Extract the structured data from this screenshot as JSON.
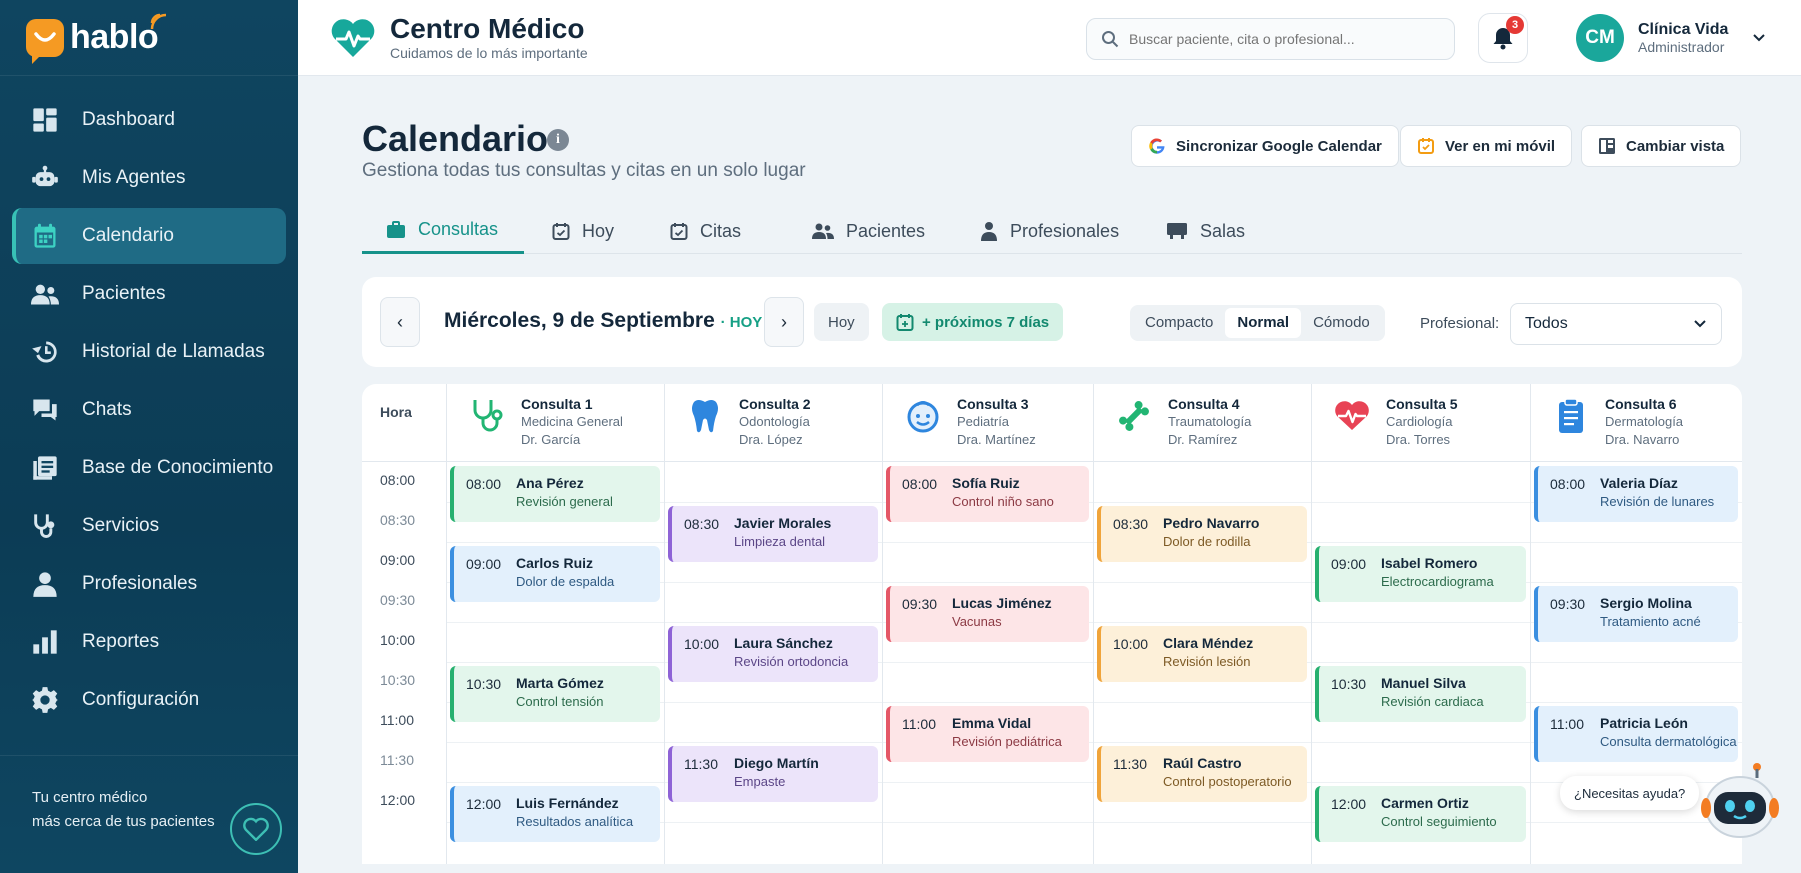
{
  "sidebar": {
    "logo": "hablo",
    "items": [
      {
        "label": "Dashboard",
        "icon": "dashboard-icon"
      },
      {
        "label": "Mis Agentes",
        "icon": "robot-icon"
      },
      {
        "label": "Calendario",
        "icon": "calendar-icon",
        "active": true
      },
      {
        "label": "Pacientes",
        "icon": "users-icon"
      },
      {
        "label": "Historial de Llamadas",
        "icon": "history-icon"
      },
      {
        "label": "Chats",
        "icon": "chat-icon"
      },
      {
        "label": "Base de Conocimiento",
        "icon": "book-icon"
      },
      {
        "label": "Servicios",
        "icon": "stethoscope-icon"
      },
      {
        "label": "Profesionales",
        "icon": "person-icon"
      },
      {
        "label": "Reportes",
        "icon": "bar-chart-icon"
      },
      {
        "label": "Configuración",
        "icon": "gear-icon"
      }
    ],
    "footer_line1": "Tu centro médico",
    "footer_line2": "más cerca de tus pacientes"
  },
  "topbar": {
    "brand_title": "Centro Médico",
    "brand_subtitle": "Cuidamos de lo más importante",
    "search_placeholder": "Buscar paciente, cita o profesional...",
    "notifications_count": "3",
    "avatar_initials": "CM",
    "user_name": "Clínica Vida",
    "user_role": "Administrador"
  },
  "page": {
    "title": "Calendario",
    "subtitle": "Gestiona todas tus consultas y citas en un solo lugar",
    "actions": {
      "sync_google": "Sincronizar Google Calendar",
      "mobile": "Ver en mi móvil",
      "change_view": "Cambiar vista"
    }
  },
  "tabs": [
    "Consultas",
    "Hoy",
    "Citas",
    "Pacientes",
    "Profesionales",
    "Salas"
  ],
  "toolbar": {
    "prev": "‹",
    "date": "Miércoles, 9 de Septiembre",
    "today_tag": "· HOY",
    "next": "›",
    "today_button": "Hoy",
    "next_7": "+ próximos 7 días",
    "density": [
      "Compacto",
      "Normal",
      "Cómodo"
    ],
    "density_selected": "Normal",
    "professional_label": "Profesional:",
    "professional_value": "Todos"
  },
  "calendar": {
    "hour_header": "Hora",
    "times": [
      "08:00",
      "08:30",
      "09:00",
      "09:30",
      "10:00",
      "10:30",
      "11:00",
      "11:30",
      "12:00"
    ],
    "columns": [
      {
        "title": "Consulta 1",
        "specialty": "Medicina General",
        "doctor": "Dr. García",
        "icon": "stethoscope-icon",
        "color": "#22b573"
      },
      {
        "title": "Consulta 2",
        "specialty": "Odontología",
        "doctor": "Dra. López",
        "icon": "tooth-icon",
        "color": "#2e86de"
      },
      {
        "title": "Consulta 3",
        "specialty": "Pediatría",
        "doctor": "Dra. Martínez",
        "icon": "baby-icon",
        "color": "#2e86de"
      },
      {
        "title": "Consulta 4",
        "specialty": "Traumatología",
        "doctor": "Dr. Ramírez",
        "icon": "bone-icon",
        "color": "#22b573"
      },
      {
        "title": "Consulta 5",
        "specialty": "Cardiología",
        "doctor": "Dra. Torres",
        "icon": "heart-pulse-icon",
        "color": "#e84355"
      },
      {
        "title": "Consulta 6",
        "specialty": "Dermatología",
        "doctor": "Dra. Navarro",
        "icon": "clipboard-icon",
        "color": "#2e86de"
      }
    ],
    "appointments": [
      {
        "col": 0,
        "slot": 0,
        "time": "08:00",
        "name": "Ana Pérez",
        "desc": "Revisión general",
        "theme": "green"
      },
      {
        "col": 0,
        "slot": 2,
        "time": "09:00",
        "name": "Carlos Ruiz",
        "desc": "Dolor de espalda",
        "theme": "blue"
      },
      {
        "col": 0,
        "slot": 5,
        "time": "10:30",
        "name": "Marta Gómez",
        "desc": "Control tensión",
        "theme": "green"
      },
      {
        "col": 0,
        "slot": 8,
        "time": "12:00",
        "name": "Luis Fernández",
        "desc": "Resultados analítica",
        "theme": "blue"
      },
      {
        "col": 1,
        "slot": 1,
        "time": "08:30",
        "name": "Javier Morales",
        "desc": "Limpieza dental",
        "theme": "purple"
      },
      {
        "col": 1,
        "slot": 4,
        "time": "10:00",
        "name": "Laura Sánchez",
        "desc": "Revisión ortodoncia",
        "theme": "purple"
      },
      {
        "col": 1,
        "slot": 7,
        "time": "11:30",
        "name": "Diego Martín",
        "desc": "Empaste",
        "theme": "purple"
      },
      {
        "col": 2,
        "slot": 0,
        "time": "08:00",
        "name": "Sofía Ruiz",
        "desc": "Control niño sano",
        "theme": "red"
      },
      {
        "col": 2,
        "slot": 3,
        "time": "09:30",
        "name": "Lucas Jiménez",
        "desc": "Vacunas",
        "theme": "red"
      },
      {
        "col": 2,
        "slot": 6,
        "time": "11:00",
        "name": "Emma Vidal",
        "desc": "Revisión pediátrica",
        "theme": "red"
      },
      {
        "col": 3,
        "slot": 1,
        "time": "08:30",
        "name": "Pedro Navarro",
        "desc": "Dolor de rodilla",
        "theme": "orange"
      },
      {
        "col": 3,
        "slot": 4,
        "time": "10:00",
        "name": "Clara Méndez",
        "desc": "Revisión lesión",
        "theme": "orange"
      },
      {
        "col": 3,
        "slot": 7,
        "time": "11:30",
        "name": "Raúl Castro",
        "desc": "Control postoperatorio",
        "theme": "orange"
      },
      {
        "col": 4,
        "slot": 2,
        "time": "09:00",
        "name": "Isabel Romero",
        "desc": "Electrocardiograma",
        "theme": "green"
      },
      {
        "col": 4,
        "slot": 5,
        "time": "10:30",
        "name": "Manuel Silva",
        "desc": "Revisión cardiaca",
        "theme": "green"
      },
      {
        "col": 4,
        "slot": 8,
        "time": "12:00",
        "name": "Carmen Ortiz",
        "desc": "Control seguimiento",
        "theme": "green"
      },
      {
        "col": 5,
        "slot": 0,
        "time": "08:00",
        "name": "Valeria Díaz",
        "desc": "Revisión de lunares",
        "theme": "blue"
      },
      {
        "col": 5,
        "slot": 3,
        "time": "09:30",
        "name": "Sergio Molina",
        "desc": "Tratamiento acné",
        "theme": "blue"
      },
      {
        "col": 5,
        "slot": 6,
        "time": "11:00",
        "name": "Patricia León",
        "desc": "Consulta dermatológica",
        "theme": "blue"
      }
    ],
    "themes": {
      "green": {
        "bg": "#e3f6ec",
        "border": "#26b06f",
        "text": "#2c6b4c"
      },
      "blue": {
        "bg": "#e3f0fc",
        "border": "#3b8fe0",
        "text": "#2f5a82"
      },
      "purple": {
        "bg": "#ece4fa",
        "border": "#8e63d6",
        "text": "#5b4687"
      },
      "red": {
        "bg": "#fde5e7",
        "border": "#e45767",
        "text": "#8c3a44"
      },
      "orange": {
        "bg": "#fdf0d9",
        "border": "#f0a43a",
        "text": "#7d5a25"
      }
    }
  },
  "help": {
    "label": "¿Necesitas ayuda?"
  },
  "colors": {
    "accent": "#16928a",
    "sidebar": "#0f4560",
    "today": "#16a085"
  }
}
